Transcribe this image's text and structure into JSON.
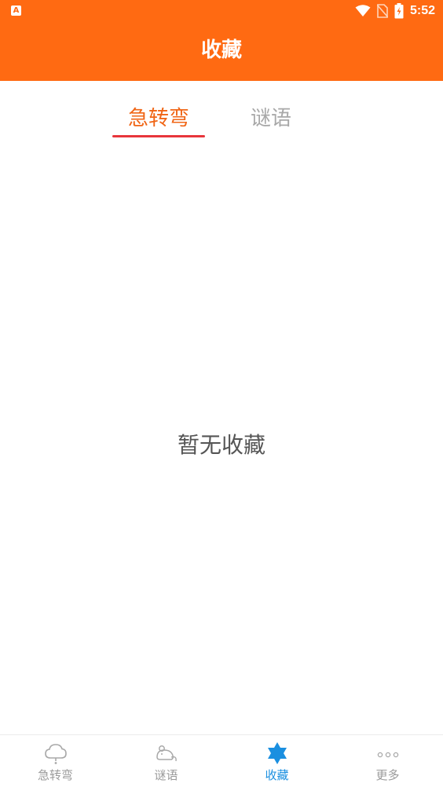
{
  "status_bar": {
    "time": "5:52",
    "left_icon": "A"
  },
  "header": {
    "title": "收藏"
  },
  "tabs": [
    {
      "label": "急转弯",
      "active": true
    },
    {
      "label": "谜语",
      "active": false
    }
  ],
  "main": {
    "empty_message": "暂无收藏"
  },
  "bottom_nav": {
    "items": [
      {
        "label": "急转弯",
        "icon": "cloud-icon",
        "active": false
      },
      {
        "label": "谜语",
        "icon": "mouse-icon",
        "active": false
      },
      {
        "label": "收藏",
        "icon": "star-icon",
        "active": true
      },
      {
        "label": "更多",
        "icon": "more-dots-icon",
        "active": false
      }
    ]
  },
  "colors": {
    "primary": "#ff6a12",
    "tab_active": "#f06515",
    "tab_underline": "#e8353b",
    "nav_active": "#1a8fe0",
    "nav_inactive": "#9a9a9a"
  }
}
